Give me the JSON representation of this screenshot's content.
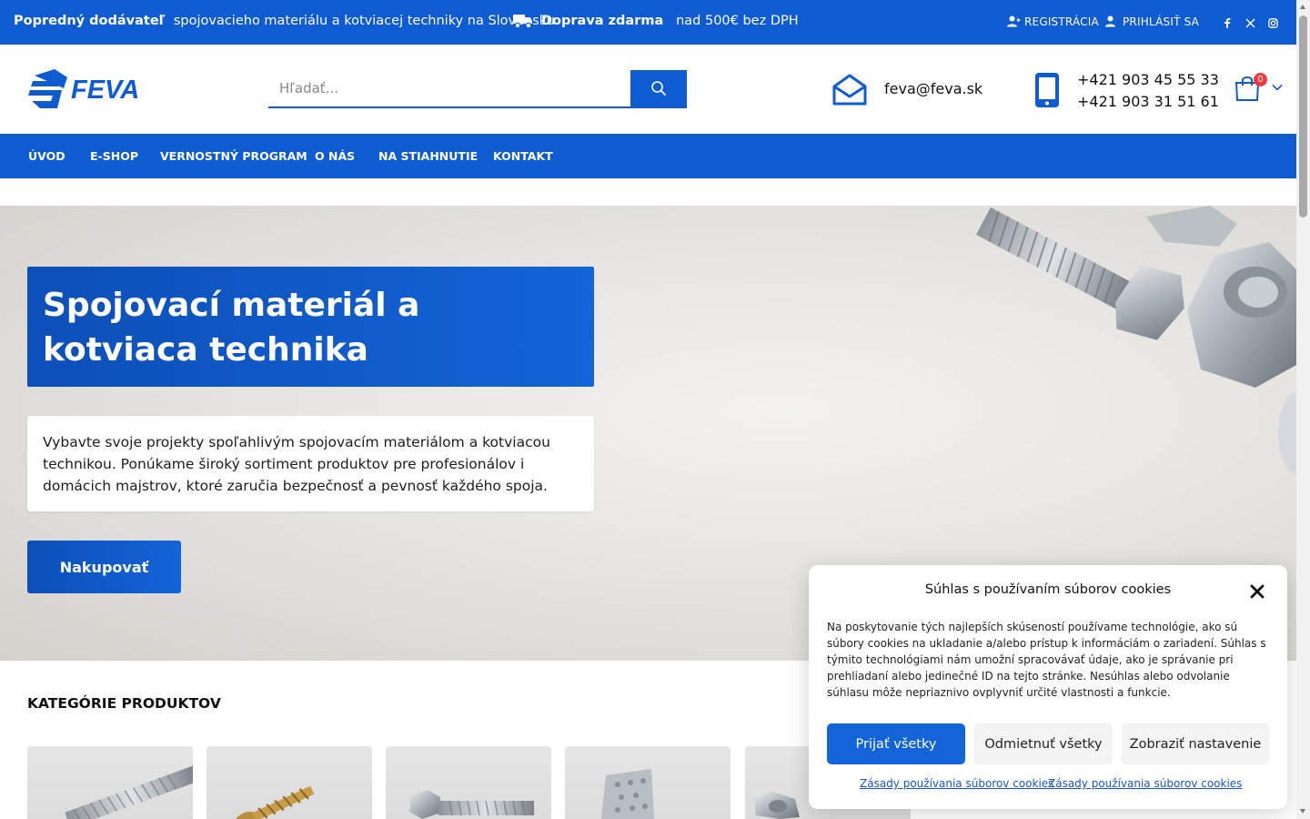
{
  "topbar": {
    "promo_bold": "Popredný dodávateľ",
    "promo_text": "spojovacieho materiálu a kotviacej techniky na Slovensku",
    "shipping_bold": "Doprava zdarma",
    "shipping_text": "nad 500€ bez DPH",
    "register_label": "Registrácia",
    "login_label": "Prihlásiť sa",
    "social": [
      "facebook-icon",
      "x-icon",
      "instagram-icon"
    ]
  },
  "header": {
    "logo_text": "FEVA",
    "search_placeholder": "Hľadať...",
    "email": "feva@feva.sk",
    "phone_1": "+421 903 45 55 33",
    "phone_2": "+421 903 31 51 61",
    "cart_count": "0"
  },
  "nav": {
    "items": [
      "Úvod",
      "E-shop",
      "Vernostný program",
      "O nás",
      "Na stiahnutie",
      "Kontakt"
    ]
  },
  "hero": {
    "title": "Spojovací materiál a kotviaca technika",
    "text": "Vybavte svoje projekty spoľahlivým spojovacím materiálom a kotviacou technikou. Ponúkame široký sortiment produktov pre profesionálov i domácich majstrov, ktoré zaručia bezpečnosť a pevnosť každého spoja.",
    "cta": "Nakupovať"
  },
  "categories": {
    "title": "Kategórie produktov"
  },
  "cookie": {
    "title": "Súhlas s používaním súborov cookies",
    "body": "Na poskytovanie tých najlepších skúseností používame technológie, ako sú súbory cookies na ukladanie a/alebo prístup k informáciám o zariadení. Súhlas s týmito technológiami nám umožní spracovávať údaje, ako je správanie pri prehliadaní alebo jedinečné ID na tejto stránke. Nesúhlas alebo odvolanie súhlasu môže nepriaznivo ovplyvniť určité vlastnosti a funkcie.",
    "accept": "Prijať všetky",
    "deny": "Odmietnuť všetky",
    "preferences": "Zobraziť nastavenie",
    "link_1": "Zásady používania súborov cookies",
    "link_2": "Zásady používania súborov cookies"
  },
  "colors": {
    "brand_blue": "#0f5bd1",
    "cart_badge": "#ee3b3b"
  }
}
